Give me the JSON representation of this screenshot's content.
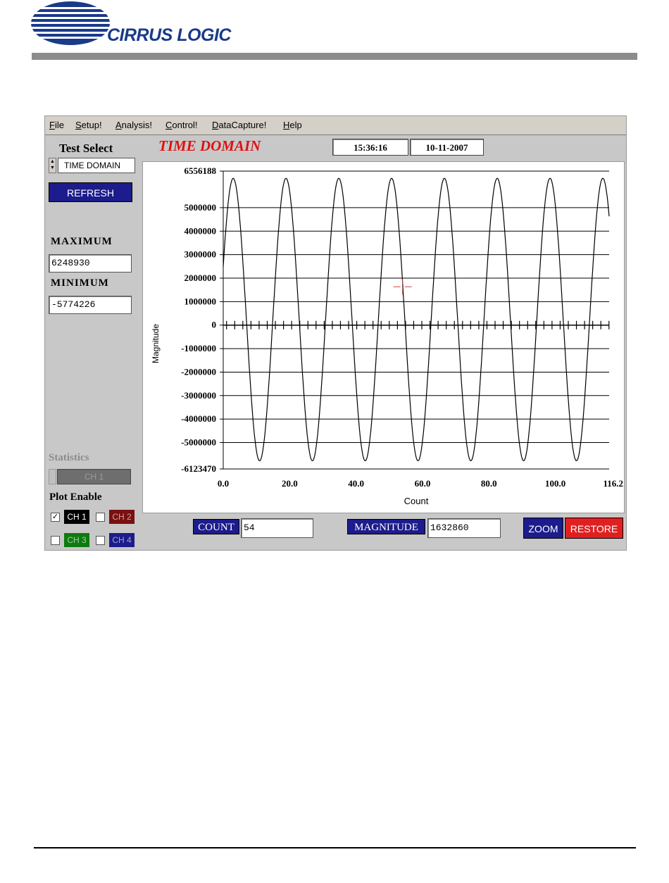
{
  "document": {
    "logo_text": "CIRRUS LOGIC"
  },
  "app": {
    "menu": [
      "File",
      "Setup!",
      "Analysis!",
      "Control!",
      "DataCapture!",
      "Help"
    ],
    "view_title": "TIME DOMAIN",
    "time": "15:36:16",
    "date": "10-11-2007",
    "test_select": {
      "label": "Test Select",
      "value": "TIME DOMAIN"
    },
    "refresh_label": "REFRESH",
    "maximum": {
      "label": "MAXIMUM",
      "value": "6248930"
    },
    "minimum": {
      "label": "MINIMUM",
      "value": "-5774226"
    },
    "statistics": {
      "label": "Statistics",
      "value": "CH 1"
    },
    "plot_enable": {
      "label": "Plot Enable",
      "channels": [
        {
          "label": "CH 1",
          "checked": true,
          "bg": "#000000",
          "fg": "#ffffff"
        },
        {
          "label": "CH 2",
          "checked": false,
          "bg": "#7a1010",
          "fg": "#d0a0a0"
        },
        {
          "label": "CH 3",
          "checked": false,
          "bg": "#0f7a0f",
          "fg": "#a0d0a0"
        },
        {
          "label": "CH 4",
          "checked": false,
          "bg": "#1c1c8c",
          "fg": "#a0a0d0"
        }
      ]
    },
    "cursor": {
      "count_label": "COUNT",
      "count_value": "54",
      "magnitude_label": "MAGNITUDE",
      "magnitude_value": "1632860"
    },
    "zoom_label": "ZOOM",
    "restore_label": "RESTORE",
    "colors": {
      "dark_blue": "#1c1c8c",
      "restore_red": "#e02020",
      "title_red": "#e01010"
    }
  },
  "chart_data": {
    "type": "line",
    "xlabel": "Count",
    "ylabel": "Magnitude",
    "xlim": [
      0.0,
      116.2
    ],
    "ylim": [
      -6123470,
      6556188
    ],
    "x_ticks": [
      "0.0",
      "20.0",
      "40.0",
      "60.0",
      "80.0",
      "100.0",
      "116.2"
    ],
    "y_ticks": [
      "6556188",
      "5000000",
      "4000000",
      "3000000",
      "2000000",
      "1000000",
      "0",
      "-1000000",
      "-2000000",
      "-3000000",
      "-4000000",
      "-5000000",
      "-6123470"
    ],
    "grid": true,
    "series": [
      {
        "waveform": "sine",
        "amplitude_max": 6248930,
        "amplitude_min": -5774226,
        "period": 15.9,
        "first_peak_x": 3.0
      }
    ],
    "cursor_point": {
      "x": 54,
      "y": 1632860
    }
  }
}
